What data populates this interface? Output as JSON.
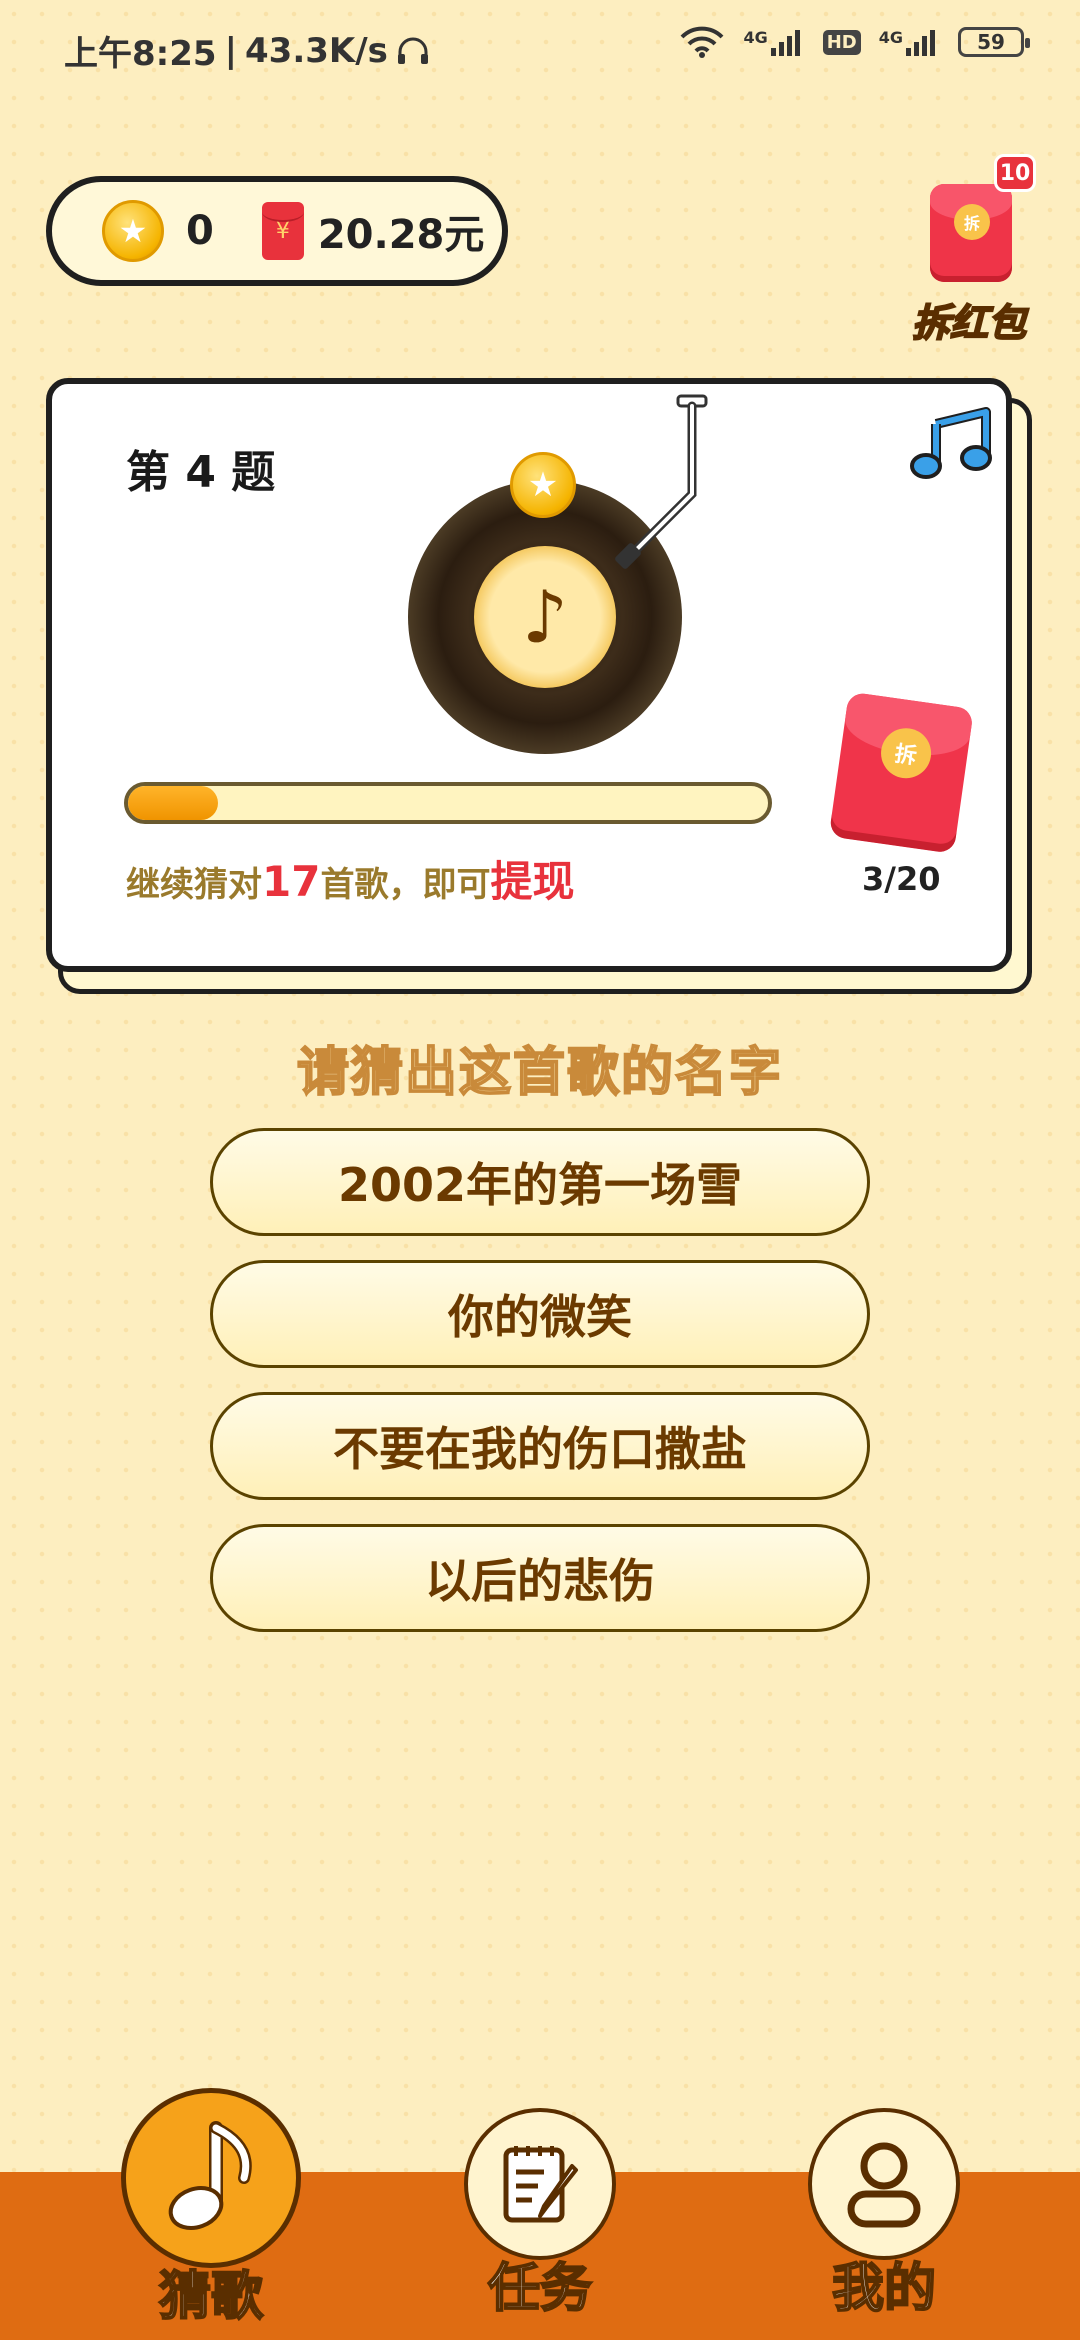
{
  "status_bar": {
    "time": "上午8:25",
    "speed": "43.3K/s",
    "net1": "4G",
    "net2": "4G",
    "hd": "HD",
    "battery": "59"
  },
  "balance": {
    "coins": "0",
    "money": "20.28元"
  },
  "split_packet": {
    "badge": "10",
    "seal": "拆",
    "label": "拆红包"
  },
  "question": {
    "title": "第 4 题",
    "progress_fraction": 0.14,
    "progress_prefix": "继续猜对",
    "progress_count": "17",
    "progress_middle": "首歌，即可",
    "progress_action": "提现",
    "packet_seal": "拆",
    "packet_count": "3/20"
  },
  "prompt": "请猜出这首歌的名字",
  "options": [
    "2002年的第一场雪",
    "你的微笑",
    "不要在我的伤口撒盐",
    "以后的悲伤"
  ],
  "nav": {
    "guess": "猜歌",
    "tasks": "任务",
    "mine": "我的"
  },
  "colors": {
    "accent": "#df6c12",
    "highlight": "#e8323c",
    "progress": "#f09400"
  }
}
